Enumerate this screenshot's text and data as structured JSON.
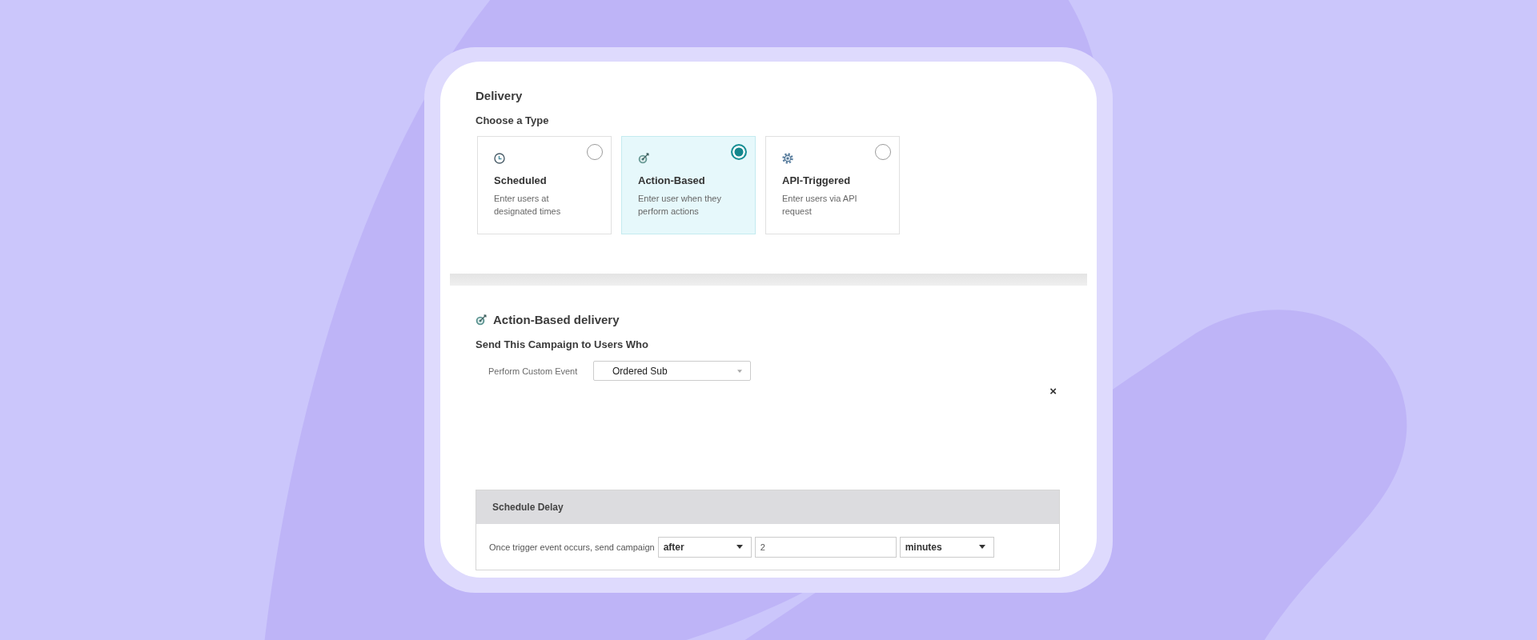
{
  "section": {
    "title": "Delivery",
    "subtitle": "Choose a Type"
  },
  "delivery_types": [
    {
      "title": "Scheduled",
      "description": "Enter users at designated times",
      "selected": false
    },
    {
      "title": "Action-Based",
      "description": "Enter user when they perform actions",
      "selected": true
    },
    {
      "title": "API-Triggered",
      "description": "Enter users via API request",
      "selected": false
    }
  ],
  "action_based": {
    "title": "Action-Based delivery",
    "subtitle": "Send This Campaign to Users Who",
    "trigger": {
      "label": "Perform Custom Event",
      "value": "Ordered Sub"
    },
    "remove_symbol": "×"
  },
  "schedule_delay": {
    "title": "Schedule Delay",
    "label": "Once trigger event occurs, send campaign",
    "timing": "after",
    "amount": "2",
    "unit": "minutes"
  }
}
